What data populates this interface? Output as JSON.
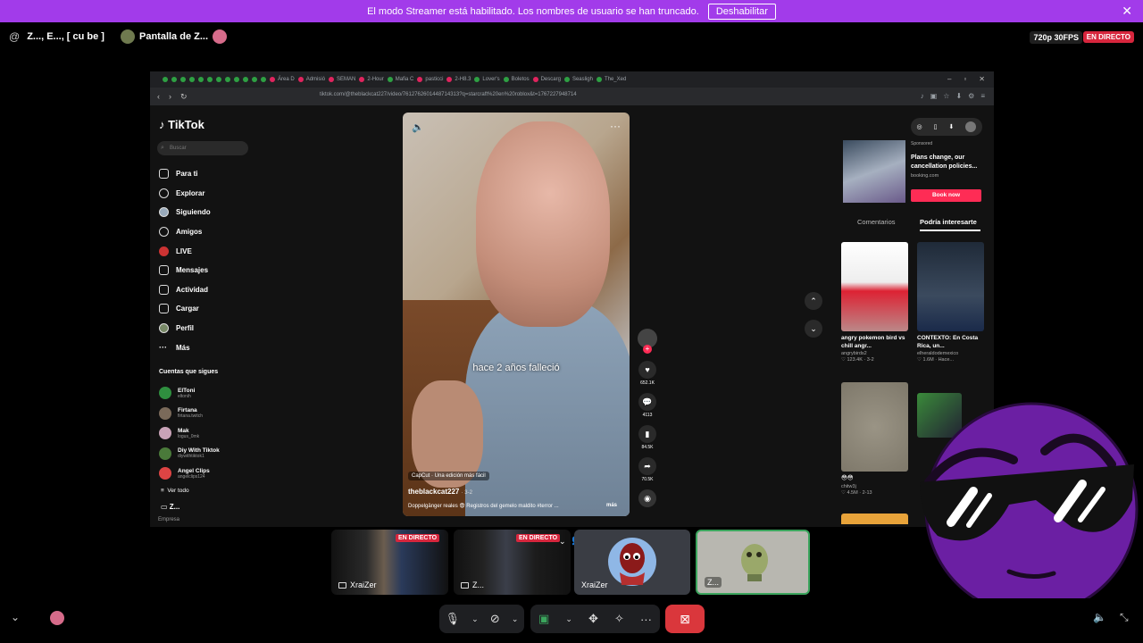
{
  "banner": {
    "message": "El modo Streamer está habilitado. Los nombres de usuario se han truncado.",
    "disable_label": "Deshabilitar",
    "close": "✕"
  },
  "call": {
    "channel_name": "Z..., E..., [ cu be ]",
    "stream_name": "Pantalla de Z...",
    "quality": "720p 30FPS",
    "live_badge": "EN DIRECTO"
  },
  "browser": {
    "tabs": [
      "Área D",
      "Admisió",
      "SEMAN",
      "2-Hour",
      "Mafia C",
      "pasticci",
      "2-H8.3",
      "Lover's",
      "Boletos",
      "Descarg",
      "Seasligh",
      "The_Xed"
    ],
    "url": "tiktok.com/@theblackcat227/video/7612762601448714313?q=starcraft%20en%20roblox&t=1767227948714"
  },
  "tiktok": {
    "logo": "TikTok",
    "search_placeholder": "Buscar",
    "nav": [
      {
        "label": "Para ti",
        "icon": "home-icon"
      },
      {
        "label": "Explorar",
        "icon": "compass-icon"
      },
      {
        "label": "Siguiendo",
        "icon": "following-icon"
      },
      {
        "label": "Amigos",
        "icon": "friends-icon"
      },
      {
        "label": "LIVE",
        "icon": "live-icon"
      },
      {
        "label": "Mensajes",
        "icon": "messages-icon"
      },
      {
        "label": "Actividad",
        "icon": "activity-icon"
      },
      {
        "label": "Cargar",
        "icon": "upload-icon"
      },
      {
        "label": "Perfil",
        "icon": "profile-icon"
      },
      {
        "label": "Más",
        "icon": "more-icon"
      }
    ],
    "following_title": "Cuentas que sigues",
    "following": [
      {
        "name": "ElToni",
        "handle": "eltonih",
        "color": "#2f8f3f"
      },
      {
        "name": "Firtana",
        "handle": "firtana.twitch",
        "color": "#7a6a5a"
      },
      {
        "name": "Mak",
        "handle": "logus_0mk",
        "color": "#c9a3b8"
      },
      {
        "name": "Diy With Tiktok",
        "handle": "diywithtiktok1",
        "color": "#4a7a3a"
      },
      {
        "name": "Angel Clips",
        "handle": "angelclips124",
        "color": "#d44"
      }
    ],
    "see_all": "Ver todo",
    "z_item": "Z...",
    "empresa": "Empresa"
  },
  "video": {
    "caption": "hace 2 años falleció",
    "capcut": "CapCut · Una edición más fácil",
    "author": "theblackcat227",
    "author_date": "· 3-2",
    "description": "Doppelgänger reales 😨 Registros del gemelo maldito #terror ...",
    "more": "más",
    "likes": "652.1K",
    "comments": "4113",
    "saves": "84.5K",
    "shares": "70.5K"
  },
  "ad": {
    "sponsored": "Sponsored",
    "title": "Plans change, our cancellation policies...",
    "domain": "booking.com",
    "button": "Book now"
  },
  "panel": {
    "tab_comments": "Comentarios",
    "tab_interest": "Podría interesarte",
    "cards": [
      {
        "title": "angry pokemon bird vs chill angr...",
        "user": "angrybirds2",
        "stats": "♡ 123.4K · 3-2"
      },
      {
        "title": "CONTEXTO: En Costa Rica, un...",
        "user": "elheraldodemexico",
        "stats": "♡ 1.6M · Hace..."
      },
      {
        "title": "😳😳",
        "user": "chitw3j",
        "stats": "♡ 4.5M · 2-13"
      }
    ]
  },
  "participants": {
    "tile1": {
      "label": "XraiZer",
      "badge": "EN DIRECTO"
    },
    "tile2": {
      "label": "Z...",
      "badge": "EN DIRECTO"
    },
    "tile3": {
      "label": "XraiZer"
    },
    "tile4": {
      "label": "Z..."
    }
  },
  "colors": {
    "banner": "#a23bea",
    "live": "#d7263d",
    "tiktok_accent": "#fe2c55",
    "end_call": "#da373c",
    "avatar_purple": "#6b1fa3"
  }
}
